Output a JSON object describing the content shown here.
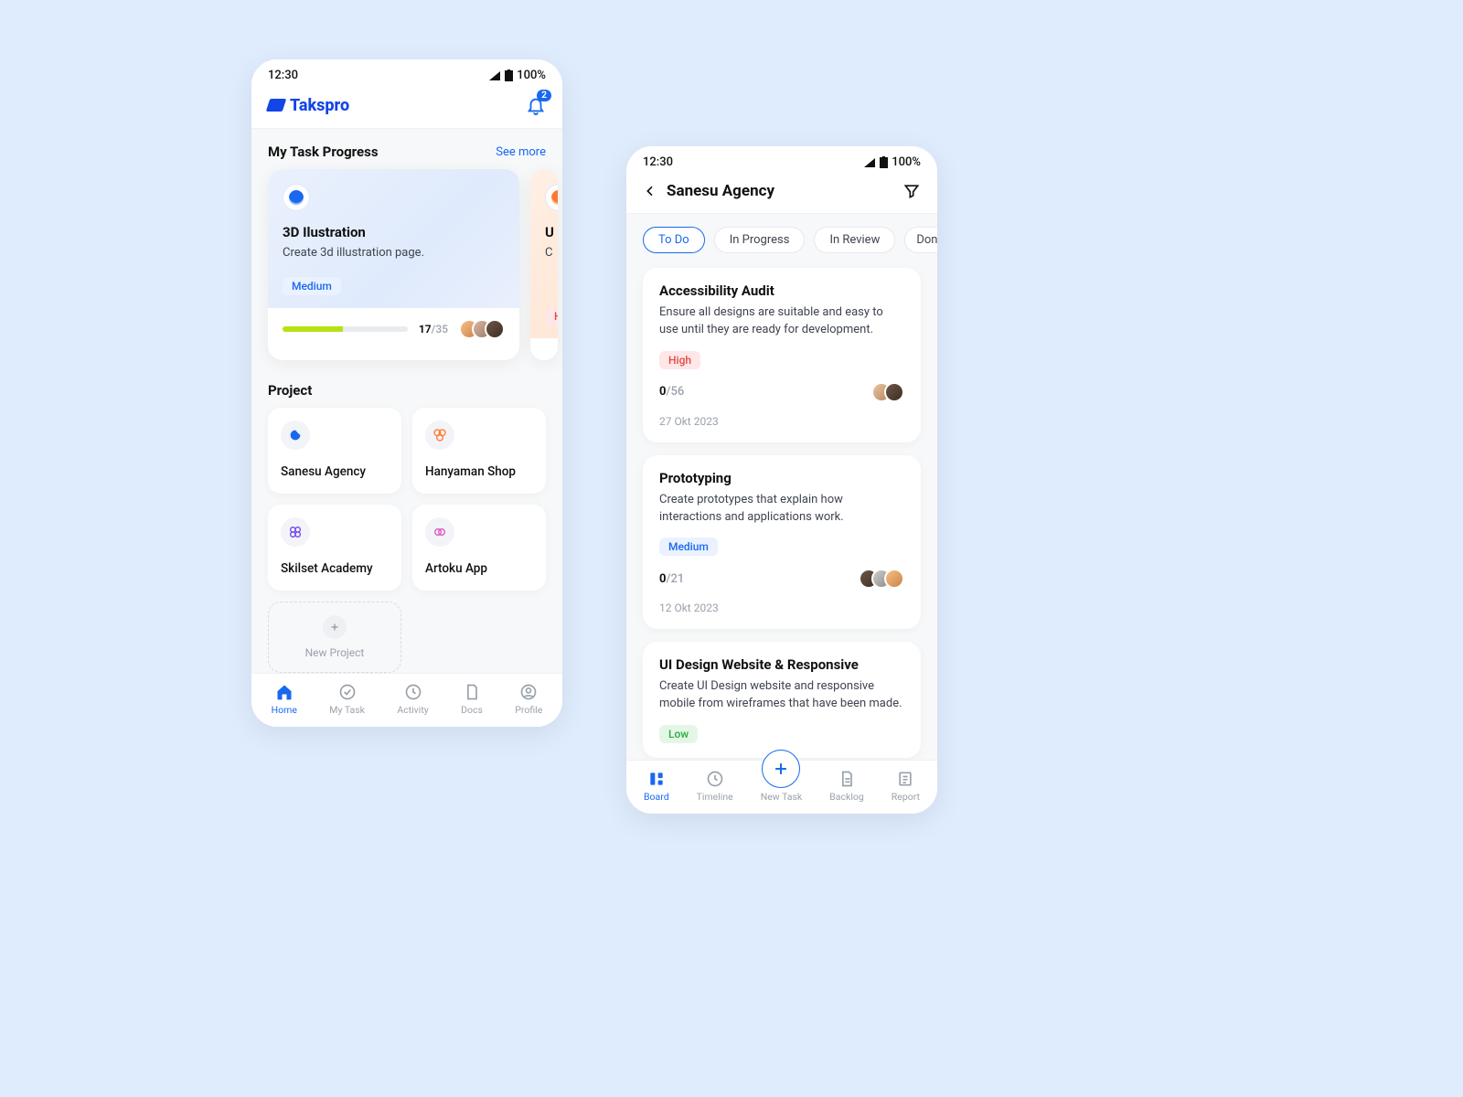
{
  "status": {
    "time": "12:30",
    "battery": "100%"
  },
  "brand_name": "Takspro",
  "notifications_count": "2",
  "screenA": {
    "section_title": "My Task Progress",
    "see_more": "See more",
    "task1": {
      "title": "3D Ilustration",
      "desc": "Create 3d illustration page.",
      "priority": "Medium",
      "done": "17",
      "total": "/35"
    },
    "task2_peek": {
      "title_initial": "U",
      "desc_initial": "C"
    },
    "project_header": "Project",
    "projects": {
      "p1": "Sanesu Agency",
      "p2": "Hanyaman Shop",
      "p3": "Skilset Academy",
      "p4": "Artoku App"
    },
    "new_project": "New Project",
    "nav": {
      "home": "Home",
      "mytask": "My Task",
      "activity": "Activity",
      "docs": "Docs",
      "profile": "Profile"
    }
  },
  "screenB": {
    "title": "Sanesu Agency",
    "chips": {
      "todo": "To Do",
      "inprogress": "In Progress",
      "inreview": "In Review",
      "done": "Done"
    },
    "cards": [
      {
        "title": "Accessibility Audit",
        "desc": "Ensure all designs are suitable and easy to use until they are ready for development.",
        "priority": "High",
        "done": "0",
        "total": "/56",
        "date": "27 Okt 2023"
      },
      {
        "title": "Prototyping",
        "desc": "Create prototypes that explain how interactions and applications work.",
        "priority": "Medium",
        "done": "0",
        "total": "/21",
        "date": "12 Okt 2023"
      },
      {
        "title": "UI Design Website & Responsive",
        "desc": "Create UI Design website and responsive mobile from wireframes that have been made.",
        "priority": "Low"
      }
    ],
    "nav": {
      "board": "Board",
      "timeline": "Timeline",
      "newtask": "New Task",
      "backlog": "Backlog",
      "report": "Report"
    }
  }
}
